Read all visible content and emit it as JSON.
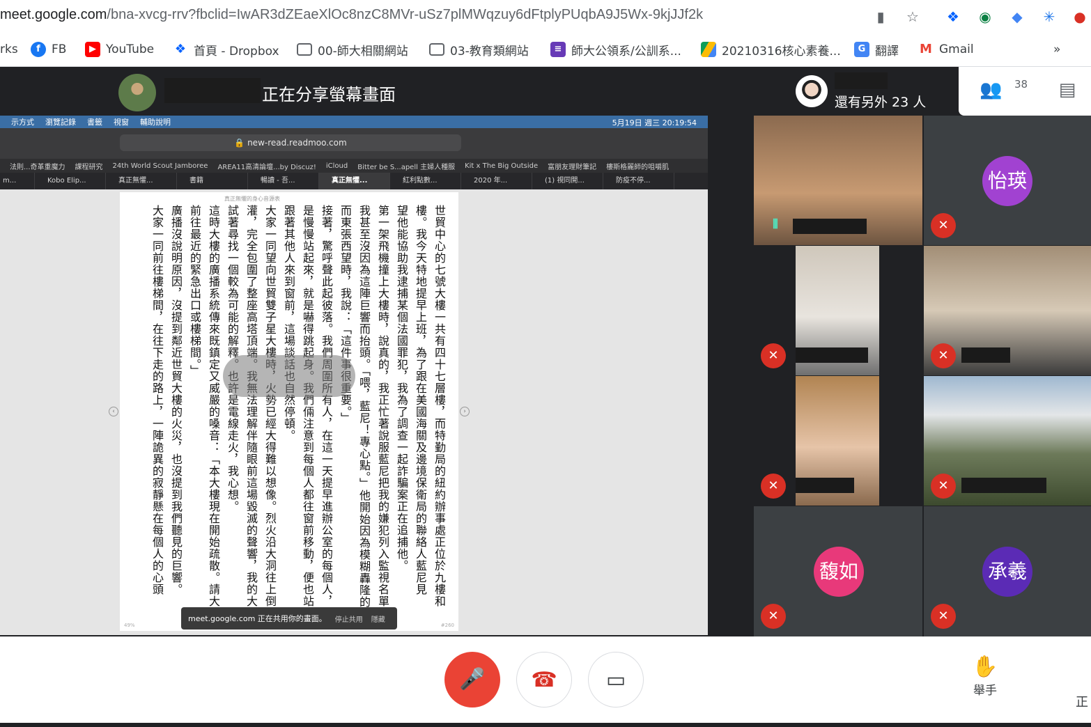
{
  "browser": {
    "url_host": "meet.google.com",
    "url_path": "/bna-xvcg-rrv?fbclid=IwAR3dZEaeXlOc8nzC8MVr-uSz7plMWqzuy6dFtplyPUqbA9J5Wx-9kjJJf2k",
    "bookmarks_cut": "rks",
    "bookmarks": [
      {
        "label": "FB",
        "icon": "facebook-icon",
        "color": "#1877f2"
      },
      {
        "label": "YouTube",
        "icon": "youtube-icon",
        "color": "#ff0000"
      },
      {
        "label": "首頁 - Dropbox",
        "icon": "dropbox-icon",
        "color": "#0061ff"
      },
      {
        "label": "00-師大相關網站",
        "icon": "folder-icon",
        "color": "#5f6368"
      },
      {
        "label": "03-教育類網站",
        "icon": "folder-icon",
        "color": "#5f6368"
      },
      {
        "label": "師大公領系/公訓系...",
        "icon": "forms-icon",
        "color": "#673ab7"
      },
      {
        "label": "20210316核心素養...",
        "icon": "drive-icon",
        "color": "#fbbc04"
      },
      {
        "label": "翻譯",
        "icon": "translate-icon",
        "color": "#4285f4"
      },
      {
        "label": "Gmail",
        "icon": "gmail-icon",
        "color": "#ea4335"
      }
    ],
    "more": "»"
  },
  "meet": {
    "presenting_text": "正在分享螢幕畫面",
    "others_text": "還有另外 23 人",
    "people_count": "38",
    "tiles": [
      {
        "name": "怡瑛"
      },
      {
        "name": "馥如"
      },
      {
        "name": "承羲"
      }
    ],
    "raise_hand_label": "舉手",
    "cut_text": "正"
  },
  "shared_screen": {
    "menu": [
      "示方式",
      "瀏覽記錄",
      "書籤",
      "視窗",
      "輔助說明"
    ],
    "clock": "5月19日 週三 20:19:54",
    "url": "new-read.readmoo.com",
    "bookmarks": [
      "法則...奇革重魔力",
      "課程研究",
      "24th World Scout Jamboree",
      "AREA11高清論壇...by Discuz!",
      "iCloud",
      "Bitter be S...apell 主婦人種服",
      "Kit x The Big Outside",
      "富朋友理財筆記",
      "樓斯格麗師的咀嚼肌"
    ],
    "tabs": [
      "m...",
      "Kobo Elip...",
      "真正無懼...",
      "書籍",
      "暢讀 - 吾...",
      "真正無懼...",
      "紅利點數...",
      "2020 年...",
      "(1) 視同開...",
      "防疫不停..."
    ],
    "page_header": "真正無懼的身心音源表",
    "text_columns": [
      "世貿中心的七號大樓一共有四十七層樓，而特勤局的紐約辦事處正位於九樓和十",
      "樓。我今天特地提早上班，為了跟在美國海關及邊境保衛局的聯絡人藍尼見面，我希",
      "望他能協助我逮捕某個法國罪犯，我為了調查一起詐騙案正在追捕他。",
      "第一架飛機撞上大樓時，說真的，我正忙著說服藍尼把我的嫌犯列入監視名單",
      "我甚至沒因為這陣巨響而抬頭。「喂，藍尼！專心點。」他開始因為模糊轟隆的聲響",
      "而東張西望時，我說：「這件事很重要。」",
      "接著，驚呼聲此起彼落。我們周圍所有人，在這一天提早進辦公室的每個人，不",
      "是慢慢站起來，就是嚇得跳起身。我們倆注意到每個人都往窗前移動，便也站起來",
      "跟著其他人來到窗前，這場談話也自然停頓。",
      "大家一同望向世貿雙子星大樓時，火勢已經大得難以想像。烈火沿大洞往上倒",
      "灌，完全包圍了整座高塔頂端。我無法理解伴隨眼前這場毀滅的聲響，我的大腦立刻",
      "試著尋找一個較為可能的解釋。也許是電線走火，我心想。",
      "這時大樓的廣播系統傳來既鎮定又威嚴的嗓音：「本大樓現在開始疏散。請大家",
      "前往最近的緊急出口或樓梯間。」",
      "廣播沒說明原因，沒提到鄰近世貿大樓的火災，也沒提到我們聽見的巨響。",
      "大家一同前往樓梯間，在往下走的路上，一陣詭異的寂靜懸在每個人的心頭上。"
    ],
    "page_pct": "49%",
    "page_num": "#260",
    "share_notice": "meet.google.com 正在共用你的畫面。",
    "stop_share": "停止共用",
    "hide": "隱藏"
  },
  "colors": {
    "meet_bg": "#202124",
    "mic_off": "#d93025",
    "avatar_purple": "#a142d1",
    "avatar_pink": "#e8397a",
    "avatar_indigo": "#5b2bb5"
  }
}
